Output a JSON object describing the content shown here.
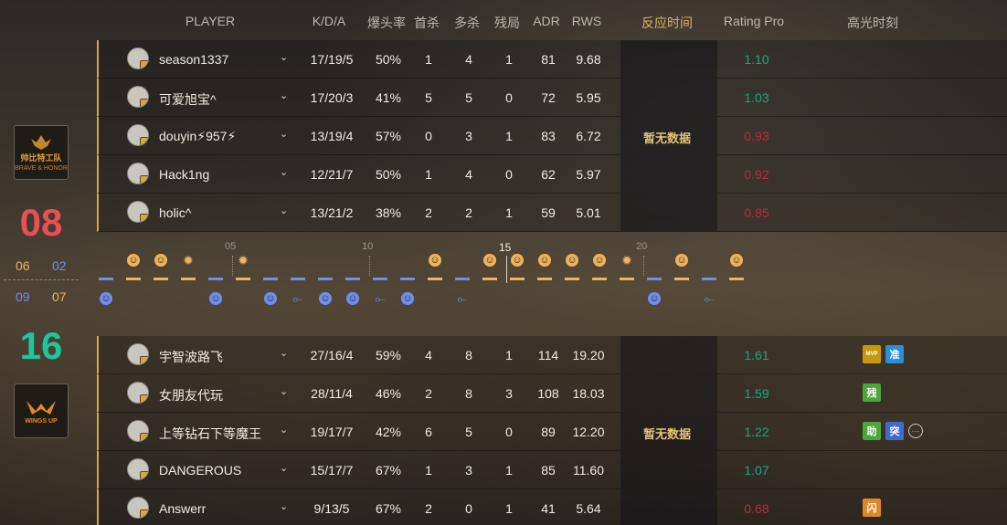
{
  "header": {
    "player": "PLAYER",
    "kda": "K/D/A",
    "hs": "爆头率",
    "fk": "首杀",
    "mk": "多杀",
    "clutch": "残局",
    "adr": "ADR",
    "rws": "RWS",
    "reaction": "反应时间",
    "rating": "Rating Pro",
    "highlights": "高光时刻"
  },
  "team1": {
    "logo_text": "帅比特工队",
    "logo_sub": "BRAVE & HONOR",
    "score": "08",
    "half_scores": [
      "06",
      "02"
    ],
    "reaction_text": "暂无数据",
    "players": [
      {
        "name": "season1337",
        "kda": "17/19/5",
        "hs": "50%",
        "fk": "1",
        "mk": "4",
        "clutch": "1",
        "adr": "81",
        "rws": "9.68",
        "rating": "1.10",
        "rating_color": "#17a782"
      },
      {
        "name": "可爱旭宝^",
        "kda": "17/20/3",
        "hs": "41%",
        "fk": "5",
        "mk": "5",
        "clutch": "0",
        "adr": "72",
        "rws": "5.95",
        "rating": "1.03",
        "rating_color": "#17a782"
      },
      {
        "name": "douyin⚡957⚡",
        "kda": "13/19/4",
        "hs": "57%",
        "fk": "0",
        "mk": "3",
        "clutch": "1",
        "adr": "83",
        "rws": "6.72",
        "rating": "0.93",
        "rating_color": "#c2293e"
      },
      {
        "name": "Hack1ng",
        "kda": "12/21/7",
        "hs": "50%",
        "fk": "1",
        "mk": "4",
        "clutch": "0",
        "adr": "62",
        "rws": "5.97",
        "rating": "0.92",
        "rating_color": "#c2293e"
      },
      {
        "name": "holic^",
        "kda": "13/21/2",
        "hs": "38%",
        "fk": "2",
        "mk": "2",
        "clutch": "1",
        "adr": "59",
        "rws": "5.01",
        "rating": "0.85",
        "rating_color": "#c2293e"
      }
    ]
  },
  "team2": {
    "logo_text": "WINGS UP",
    "score": "16",
    "half_scores": [
      "09",
      "07"
    ],
    "reaction_text": "暂无数据",
    "players": [
      {
        "name": "宇智波路飞",
        "kda": "27/16/4",
        "hs": "59%",
        "fk": "4",
        "mk": "8",
        "clutch": "1",
        "adr": "114",
        "rws": "19.20",
        "rating": "1.61",
        "rating_color": "#17a782",
        "tags": [
          {
            "text": "MVP",
            "color": "#c9970f"
          },
          {
            "text": "准",
            "color": "#2a8fd6"
          }
        ]
      },
      {
        "name": "女朋友代玩",
        "kda": "28/11/4",
        "hs": "46%",
        "fk": "2",
        "mk": "8",
        "clutch": "3",
        "adr": "108",
        "rws": "18.03",
        "rating": "1.59",
        "rating_color": "#17a782",
        "tags": [
          {
            "text": "残",
            "color": "#4ca63b"
          }
        ]
      },
      {
        "name": "上等钻石下等魔王",
        "kda": "19/17/7",
        "hs": "42%",
        "fk": "6",
        "mk": "5",
        "clutch": "0",
        "adr": "89",
        "rws": "12.20",
        "rating": "1.22",
        "rating_color": "#17a782",
        "tags": [
          {
            "text": "助",
            "color": "#4ca63b"
          },
          {
            "text": "突",
            "color": "#3f6bd1"
          }
        ],
        "more": "···"
      },
      {
        "name": "DANGEROUS",
        "kda": "15/17/7",
        "hs": "67%",
        "fk": "1",
        "mk": "3",
        "clutch": "1",
        "adr": "85",
        "rws": "11.60",
        "rating": "1.07",
        "rating_color": "#17a782"
      },
      {
        "name": "Answerr",
        "kda": "9/13/5",
        "hs": "67%",
        "fk": "2",
        "mk": "0",
        "clutch": "1",
        "adr": "41",
        "rws": "5.64",
        "rating": "0.68",
        "rating_color": "#c2293e",
        "tags": [
          {
            "text": "闪",
            "color": "#d98a2a"
          }
        ]
      }
    ]
  },
  "timeline": {
    "labels": [
      "05",
      "10",
      "15",
      "20"
    ],
    "current_round": "15",
    "colors": {
      "t": "#f0b35a",
      "ct": "#6f8ff0"
    },
    "rounds": [
      {
        "win": "ct",
        "icon": "smile"
      },
      {
        "win": "t",
        "icon": "smile"
      },
      {
        "win": "t",
        "icon": "smile"
      },
      {
        "win": "t",
        "icon": "burst"
      },
      {
        "win": "ct",
        "icon": "smile"
      },
      {
        "win": "t",
        "icon": "burst"
      },
      {
        "win": "ct",
        "icon": "smile"
      },
      {
        "win": "ct",
        "icon": "defuse"
      },
      {
        "win": "ct",
        "icon": "smile"
      },
      {
        "win": "ct",
        "icon": "smile"
      },
      {
        "win": "ct",
        "icon": "defuse"
      },
      {
        "win": "ct",
        "icon": "smile"
      },
      {
        "win": "t",
        "icon": "smile"
      },
      {
        "win": "ct",
        "icon": "defuse"
      },
      {
        "win": "t",
        "icon": "smile"
      },
      {
        "win": "t",
        "icon": "smile"
      },
      {
        "win": "t",
        "icon": "smile"
      },
      {
        "win": "t",
        "icon": "smile"
      },
      {
        "win": "t",
        "icon": "smile"
      },
      {
        "win": "t",
        "icon": "burst"
      },
      {
        "win": "ct",
        "icon": "smile"
      },
      {
        "win": "t",
        "icon": "smile"
      },
      {
        "win": "ct",
        "icon": "defuse"
      },
      {
        "win": "t",
        "icon": "smile"
      }
    ]
  }
}
